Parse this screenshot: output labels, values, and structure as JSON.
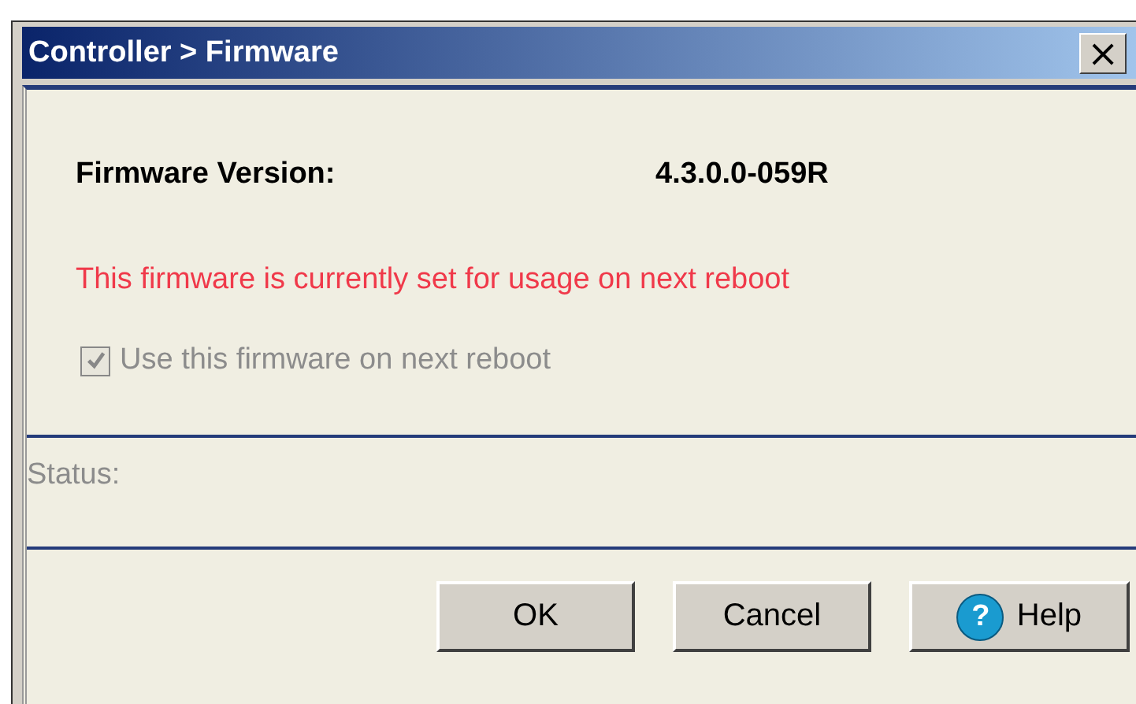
{
  "window": {
    "title": "Controller > Firmware",
    "close_glyph": "×"
  },
  "firmware": {
    "label": "Firmware Version:",
    "value": "4.3.0.0-059R"
  },
  "message": "This firmware is currently set for usage on next reboot",
  "checkbox": {
    "label": "Use this firmware on next reboot",
    "checked": true,
    "disabled": true
  },
  "status": {
    "label": "Status:"
  },
  "buttons": [
    {
      "label": "OK",
      "kind": "plain"
    },
    {
      "label": "Cancel",
      "kind": "plain"
    },
    {
      "label": "Help",
      "kind": "help",
      "glyph": "?"
    }
  ]
}
